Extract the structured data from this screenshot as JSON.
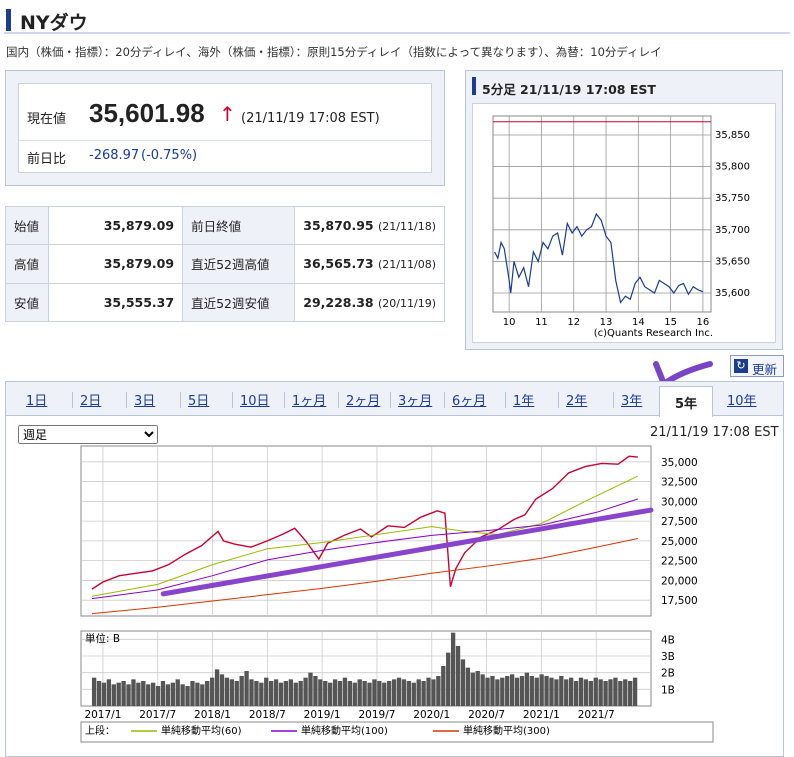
{
  "page": {
    "title": "NYダウ",
    "notice": "国内（株価・指標）：20分ディレイ、海外（株価・指標）：原則15分ディレイ（指数によって異なります）、為替：10分ディレイ"
  },
  "current": {
    "label": "現在値",
    "price": "35,601.98",
    "arrow": "↑",
    "time": "(21/11/19 17:08 EST)",
    "change_label": "前日比",
    "change": "-268.97",
    "change_pct": "(-0.75%)"
  },
  "quotes": {
    "open_label": "始値",
    "open": "35,879.09",
    "high_label": "高値",
    "high": "35,879.09",
    "low_label": "安値",
    "low": "35,555.37",
    "prev_close_label": "前日終値",
    "prev_close": "35,870.95",
    "prev_close_date": "(21/11/18)",
    "high52_label": "直近52週高値",
    "high52": "36,565.73",
    "high52_date": "(21/11/08)",
    "low52_label": "直近52週安値",
    "low52": "29,228.38",
    "low52_date": "(20/11/19)"
  },
  "intraday": {
    "header": "5分足 21/11/19 17:08 EST",
    "credit": "(c)Quants Research Inc."
  },
  "refresh_label": "更新",
  "tabs": [
    "1日",
    "2日",
    "3日",
    "5日",
    "10日",
    "1ヶ月",
    "2ヶ月",
    "3ヶ月",
    "6ヶ月",
    "1年",
    "2年",
    "3年",
    "5年",
    "10年"
  ],
  "active_tab": "5年",
  "period_select": "週足",
  "chart_time": "21/11/19 17:08 EST",
  "colors": {
    "accent": "#1b3d8f",
    "price_line": "#cc0033",
    "down": "#1a3a9c",
    "ma60": "#99bb00",
    "ma100": "#8800cc",
    "ma300": "#dd3300",
    "trend": "#8844cc"
  },
  "chart_data": [
    {
      "type": "line",
      "title": "5分足 21/11/19 17:08 EST",
      "x_ticks": [
        "10",
        "11",
        "12",
        "13",
        "14",
        "15",
        "16"
      ],
      "y_ticks": [
        "35,850",
        "35,800",
        "35,750",
        "35,700",
        "35,650",
        "35,600"
      ],
      "ylim": [
        35570,
        35880
      ],
      "xlim": [
        9.5,
        16.25
      ],
      "reference_line": 35870.95,
      "x": [
        9.55,
        9.65,
        9.75,
        9.85,
        10.0,
        10.05,
        10.15,
        10.3,
        10.45,
        10.6,
        10.75,
        10.9,
        11.05,
        11.2,
        11.35,
        11.5,
        11.65,
        11.8,
        11.95,
        12.1,
        12.25,
        12.4,
        12.55,
        12.7,
        12.85,
        13.0,
        13.15,
        13.3,
        13.45,
        13.6,
        13.75,
        13.9,
        14.05,
        14.2,
        14.35,
        14.5,
        14.65,
        14.8,
        14.95,
        15.1,
        15.25,
        15.4,
        15.55,
        15.7,
        15.85,
        16.0
      ],
      "values": [
        35665,
        35655,
        35680,
        35670,
        35620,
        35600,
        35650,
        35625,
        35640,
        35610,
        35665,
        35650,
        35680,
        35670,
        35690,
        35695,
        35660,
        35710,
        35695,
        35705,
        35690,
        35700,
        35705,
        35725,
        35715,
        35690,
        35680,
        35620,
        35585,
        35595,
        35590,
        35615,
        35625,
        35610,
        35605,
        35600,
        35620,
        35615,
        35610,
        35600,
        35612,
        35615,
        35598,
        35610,
        35605,
        35602
      ]
    },
    {
      "type": "line",
      "title": "週足",
      "x_ticks": [
        "2017/1",
        "2017/7",
        "2018/1",
        "2018/7",
        "2019/1",
        "2019/7",
        "2020/1",
        "2020/7",
        "2021/1",
        "2021/7"
      ],
      "y_ticks": [
        "35,000",
        "32,500",
        "30,000",
        "27,500",
        "25,000",
        "22,500",
        "20,000",
        "17,500"
      ],
      "ylim": [
        15500,
        37000
      ],
      "xlim": [
        2016.8,
        2022.0
      ],
      "series": [
        {
          "name": "",
          "x": [
            2016.9,
            2017.0,
            2017.15,
            2017.3,
            2017.45,
            2017.6,
            2017.75,
            2017.9,
            2018.05,
            2018.1,
            2018.2,
            2018.35,
            2018.5,
            2018.65,
            2018.75,
            2018.85,
            2018.97,
            2019.05,
            2019.2,
            2019.35,
            2019.45,
            2019.6,
            2019.75,
            2019.9,
            2020.05,
            2020.12,
            2020.17,
            2020.22,
            2020.3,
            2020.45,
            2020.6,
            2020.75,
            2020.85,
            2020.95,
            2021.1,
            2021.25,
            2021.4,
            2021.55,
            2021.7,
            2021.8,
            2021.88
          ],
          "values": [
            18900,
            19800,
            20600,
            20900,
            21200,
            22000,
            23300,
            24400,
            26200,
            25000,
            24600,
            24200,
            25000,
            25900,
            26600,
            25000,
            22700,
            24700,
            25700,
            26500,
            25500,
            26900,
            26700,
            28000,
            28800,
            28500,
            19200,
            21500,
            23500,
            25500,
            26400,
            27700,
            28300,
            30300,
            31600,
            33600,
            34400,
            34800,
            34700,
            35700,
            35602
          ]
        },
        {
          "name": "単純移動平均(60)",
          "x": [
            2016.9,
            2017.5,
            2018.0,
            2018.5,
            2019.0,
            2019.5,
            2020.0,
            2020.3,
            2020.6,
            2021.0,
            2021.4,
            2021.88
          ],
          "values": [
            18000,
            19500,
            22000,
            24000,
            24800,
            25800,
            26800,
            26200,
            25800,
            27200,
            30000,
            33200
          ]
        },
        {
          "name": "単純移動平均(100)",
          "x": [
            2016.9,
            2017.5,
            2018.0,
            2018.5,
            2019.0,
            2019.5,
            2020.0,
            2020.5,
            2021.0,
            2021.5,
            2021.88
          ],
          "values": [
            17700,
            18800,
            20600,
            22600,
            23800,
            24800,
            25700,
            26300,
            27000,
            28600,
            30300
          ]
        },
        {
          "name": "単純移動平均(300)",
          "x": [
            2016.9,
            2017.5,
            2018.0,
            2018.5,
            2019.0,
            2019.5,
            2020.0,
            2020.5,
            2021.0,
            2021.5,
            2021.88
          ],
          "values": [
            15800,
            16600,
            17400,
            18200,
            19000,
            19900,
            20900,
            21800,
            22800,
            24200,
            25300
          ]
        }
      ],
      "trendline": {
        "x": [
          2017.55,
          2022.0
        ],
        "values": [
          18300,
          28900
        ]
      },
      "volume": {
        "unit_label": "単位: B",
        "y_ticks": [
          "4B",
          "3B",
          "2B",
          "1B"
        ],
        "ylim": [
          0,
          4.5
        ],
        "values": [
          1.7,
          1.5,
          1.4,
          1.6,
          1.3,
          1.4,
          1.5,
          1.3,
          1.6,
          1.4,
          1.5,
          1.3,
          1.4,
          1.2,
          1.5,
          1.3,
          1.4,
          1.6,
          1.3,
          1.2,
          1.5,
          1.4,
          1.3,
          1.5,
          1.7,
          2.2,
          1.9,
          1.7,
          1.6,
          1.5,
          1.8,
          2.1,
          1.6,
          1.5,
          1.4,
          1.7,
          1.5,
          1.6,
          1.4,
          1.5,
          1.6,
          1.4,
          1.5,
          1.7,
          2.0,
          1.8,
          1.6,
          1.5,
          1.4,
          1.6,
          1.5,
          1.7,
          1.5,
          1.4,
          1.6,
          1.5,
          1.4,
          1.6,
          1.5,
          1.4,
          1.5,
          1.6,
          1.7,
          1.6,
          1.5,
          1.4,
          1.6,
          1.5,
          1.7,
          1.6,
          1.8,
          2.4,
          3.2,
          4.4,
          3.6,
          2.8,
          2.3,
          2.0,
          2.1,
          1.9,
          1.7,
          1.8,
          1.6,
          1.7,
          1.8,
          1.9,
          1.7,
          1.8,
          2.0,
          1.8,
          1.7,
          1.9,
          1.8,
          1.7,
          1.6,
          1.8,
          1.6,
          1.7,
          1.5,
          1.7,
          1.6,
          1.5,
          1.7,
          1.6,
          1.5,
          1.6,
          1.7,
          1.5,
          1.6,
          1.5,
          1.7
        ]
      },
      "legend": {
        "prefix": "上段：",
        "items": [
          "単純移動平均(60)",
          "単純移動平均(100)",
          "単純移動平均(300)"
        ]
      }
    }
  ]
}
